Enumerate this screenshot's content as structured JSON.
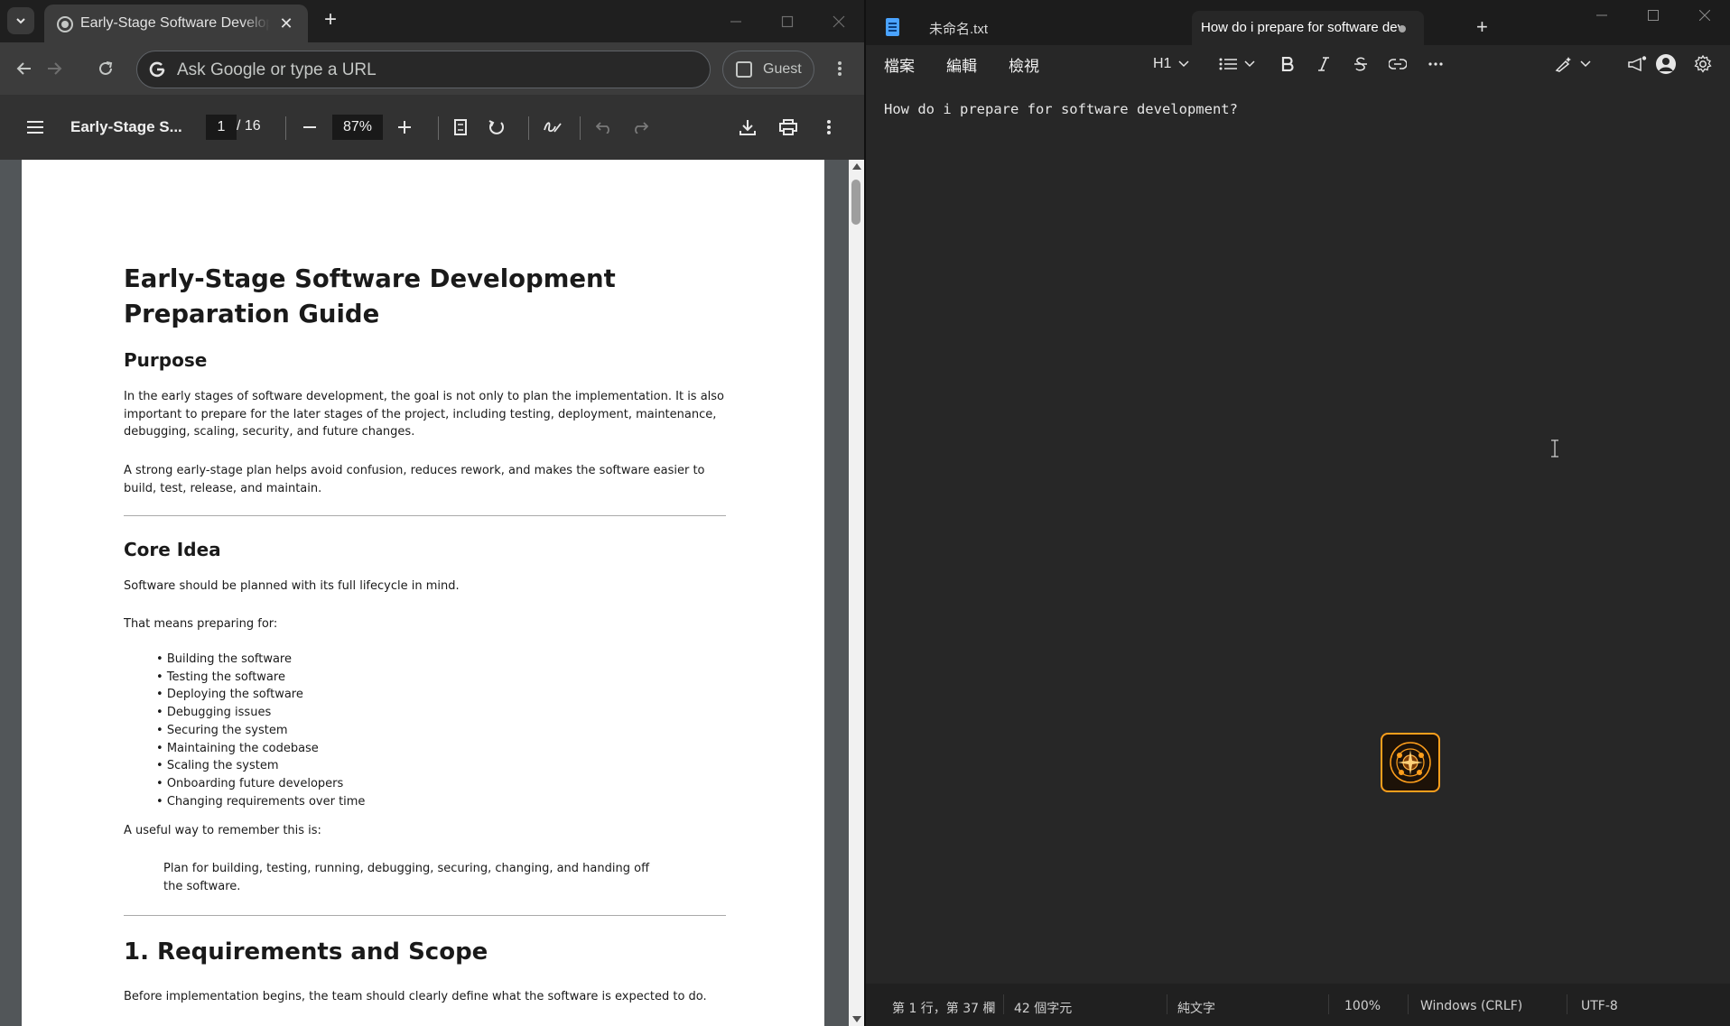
{
  "chrome": {
    "tab_title": "Early-Stage Software Develop",
    "tab_close": "✕",
    "new_tab": "+",
    "omnibox_placeholder": "Ask Google or type a URL",
    "guest_label": "Guest"
  },
  "pdf": {
    "doc_title": "Early-Stage S...",
    "page_current": "1",
    "page_total": "/ 16",
    "zoom": "87%",
    "content": {
      "title": "Early-Stage Software Development Preparation Guide",
      "purpose_heading": "Purpose",
      "purpose_p1": "In the early stages of software development, the goal is not only to plan the implementation. It is also important to prepare for the later stages of the project, including testing, deployment, maintenance, debugging, scaling, security, and future changes.",
      "purpose_p2": "A strong early-stage plan helps avoid confusion, reduces rework, and makes the software easier to build, test, release, and maintain.",
      "core_heading": "Core Idea",
      "core_p1": "Software should be planned with its full lifecycle in mind.",
      "core_p2": "That means preparing for:",
      "core_list": [
        "Building the software",
        "Testing the software",
        "Deploying the software",
        "Debugging issues",
        "Securing the system",
        "Maintaining the codebase",
        "Scaling the system",
        "Onboarding future developers",
        "Changing requirements over time"
      ],
      "remember_intro": "A useful way to remember this is:",
      "remember_quote": "Plan for building, testing, running, debugging, securing, changing, and handing off the software.",
      "req_heading": "1. Requirements and Scope",
      "req_p1": "Before implementation begins, the team should clearly define what the software is expected to do."
    }
  },
  "notepad": {
    "tab1_title": "未命名.txt",
    "tab2_title": "How do i prepare for software deve",
    "new_tab": "+",
    "menu": [
      "檔案",
      "編輯",
      "檢視"
    ],
    "heading_label": "H1",
    "editor_text": "How do i prepare for software development?",
    "status": {
      "position": "第 1 行，第 37 欄",
      "chars": "42 個字元",
      "format": "純文字",
      "zoom": "100%",
      "line_ending": "Windows (CRLF)",
      "encoding": "UTF-8"
    }
  },
  "colors": {
    "chrome_bg": "#282828",
    "pdf_bg": "#525659",
    "notepad_bg": "#272727",
    "accent_orange": "#ff9f1c"
  }
}
